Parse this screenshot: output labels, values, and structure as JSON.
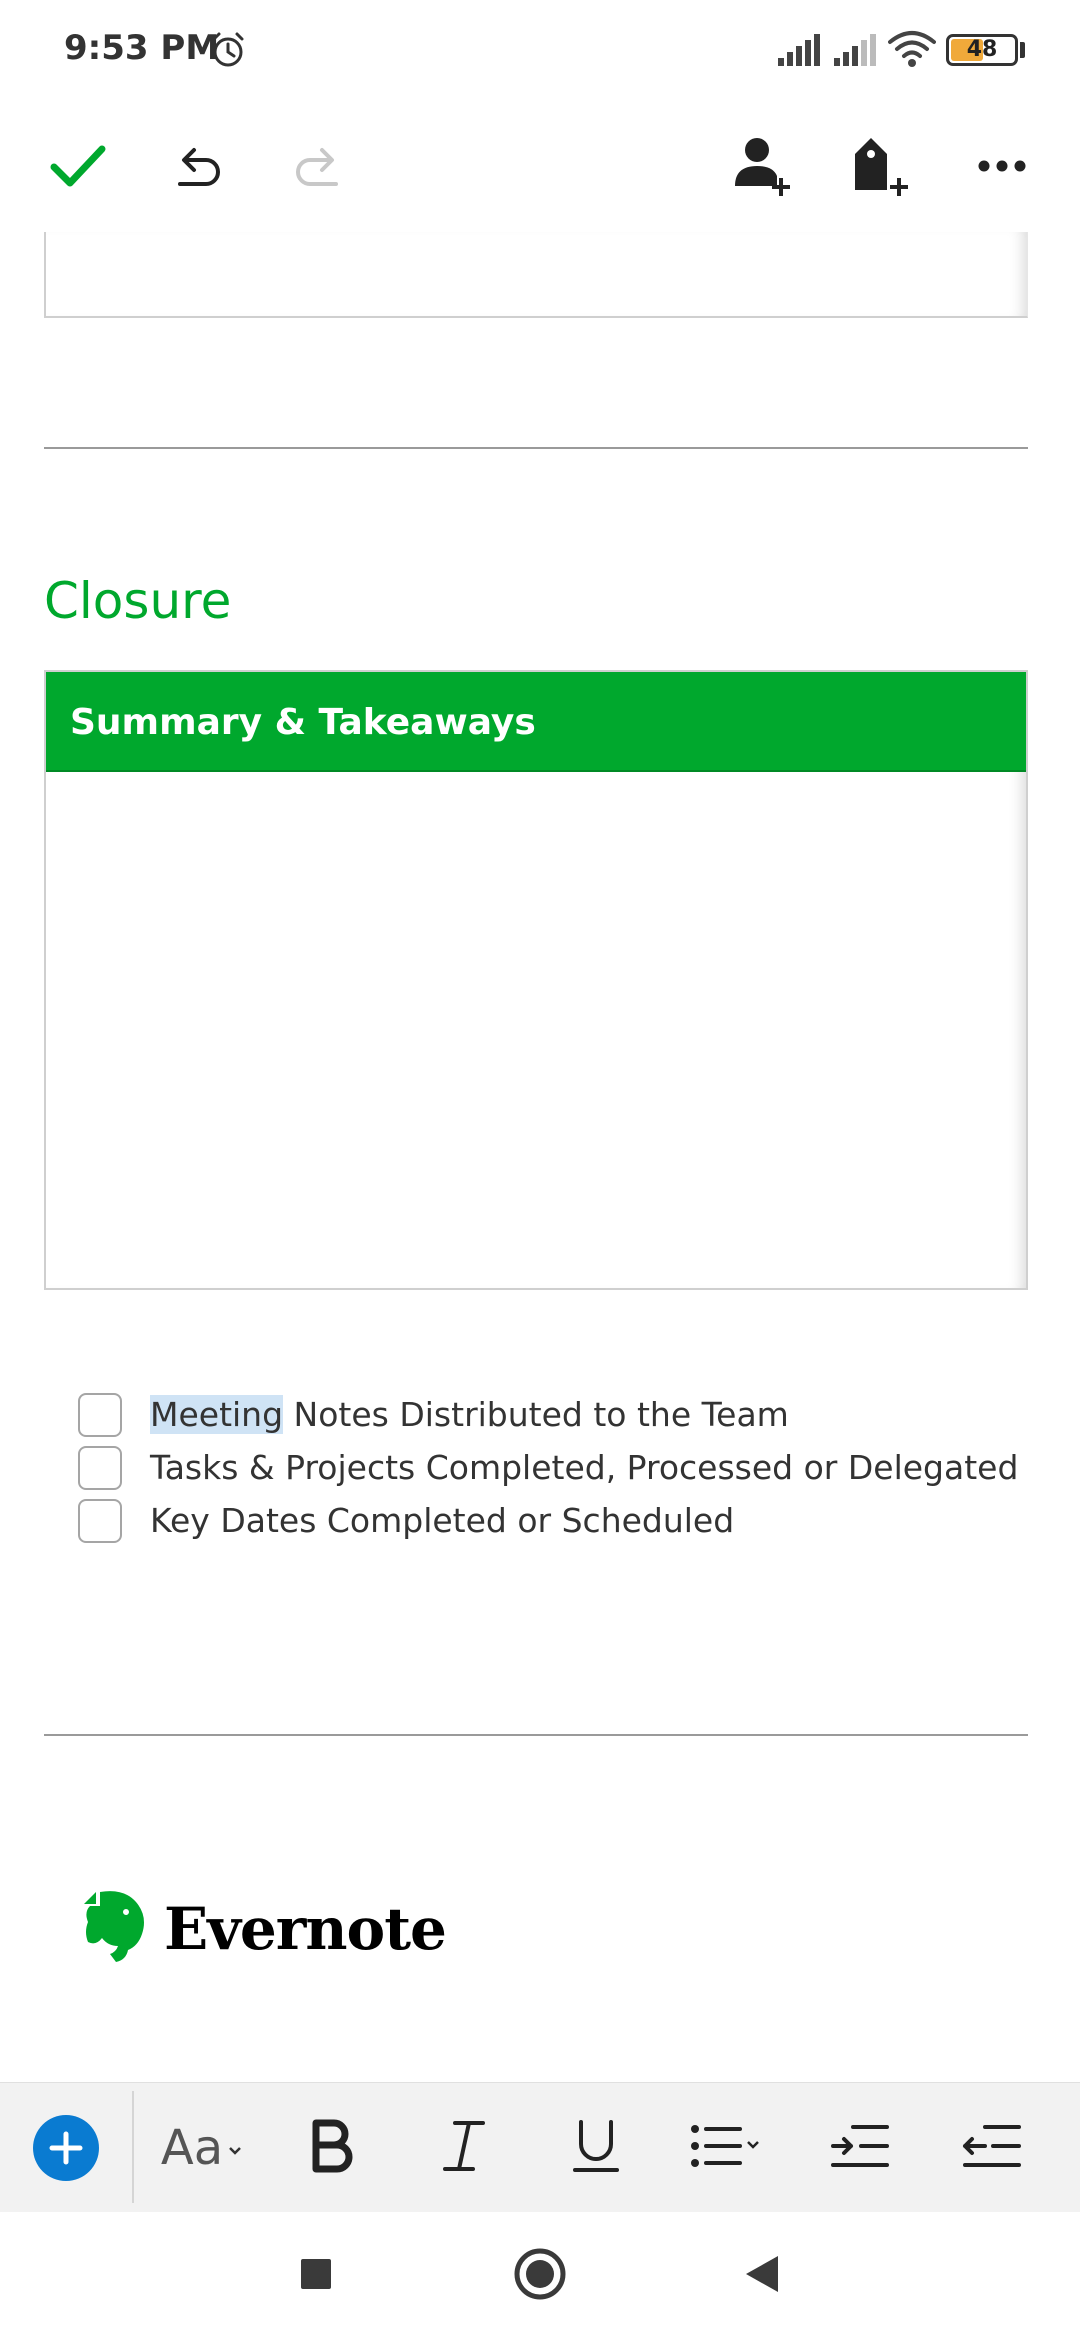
{
  "status_bar": {
    "time": "9:53 PM",
    "battery_level": "48",
    "icons": [
      "alarm-icon",
      "signal-icon",
      "signal-icon",
      "wifi-icon",
      "battery-icon"
    ]
  },
  "app_toolbar": {
    "icons": [
      "check-icon",
      "undo-icon",
      "redo-icon",
      "add-person-icon",
      "add-tag-icon",
      "more-icon"
    ]
  },
  "note": {
    "section_heading": "Closure",
    "table_header": "Summary & Takeaways",
    "checklist": [
      {
        "highlighted": "Meeting",
        "rest": " Notes Distributed to the Team",
        "checked": false
      },
      {
        "highlighted": "",
        "rest": "Tasks & Projects Completed, Processed or Delegated",
        "checked": false
      },
      {
        "highlighted": "",
        "rest": "Key Dates Completed or Scheduled",
        "checked": false
      }
    ],
    "logo_text": "Evernote"
  },
  "format_bar": {
    "font_button_label": "Aa",
    "icons": [
      "add-icon",
      "font-style-icon",
      "bold-icon",
      "italic-icon",
      "underline-icon",
      "bullet-list-icon",
      "indent-icon",
      "outdent-icon"
    ]
  },
  "nav_bar": {
    "icons": [
      "recents-icon",
      "home-icon",
      "back-icon"
    ]
  },
  "colors": {
    "accent_green": "#00a82d",
    "add_button_blue": "#0a7bd1",
    "annotation_red": "#ff0000",
    "selection_highlight": "#cfe3f5"
  }
}
